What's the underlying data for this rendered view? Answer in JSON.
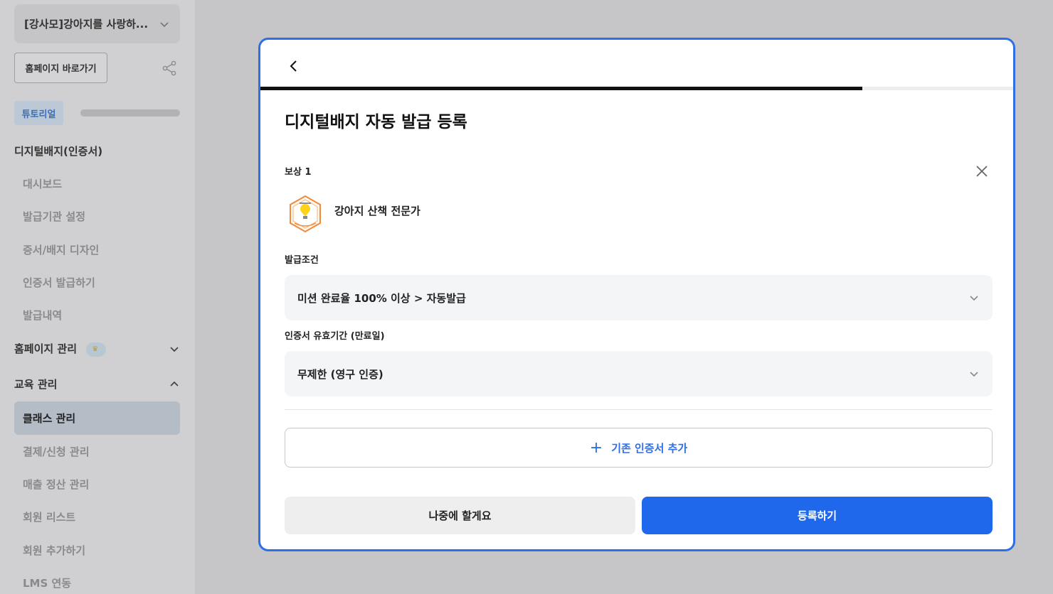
{
  "sidebar": {
    "workspace": "[강사모]강아지를 사랑하...",
    "home_button": "홈페이지 바로가기",
    "tutorial": "튜토리얼",
    "sections": {
      "digital_badge": "디지털배지(인증서)",
      "homepage_manage": "홈페이지 관리",
      "education_manage": "교육 관리"
    },
    "badge_items": [
      "대시보드",
      "발급기관 설정",
      "증서/배지 디자인",
      "인증서 발급하기",
      "발급내역"
    ],
    "education_items": [
      "클래스 관리",
      "결제/신청 관리",
      "매출 정산 관리",
      "회원 리스트",
      "회원 추가하기",
      "LMS 연동"
    ]
  },
  "modal": {
    "title": "디지털배지 자동 발급 등록",
    "progress": 0.8,
    "reward_label": "보상 1",
    "badge_name": "강아지 산책 전문가",
    "condition_label": "발급조건",
    "condition_value": "미션 완료율 100% 이상 > 자동발급",
    "validity_label": "인증서 유효기간 (만료일)",
    "validity_value": "무제한 (영구 인증)",
    "add_button": "기존 인증서 추가",
    "later_button": "나중에 할게요",
    "submit_button": "등록하기"
  },
  "colors": {
    "accent": "#1f68ec",
    "modal_border": "#2f6fe4"
  }
}
